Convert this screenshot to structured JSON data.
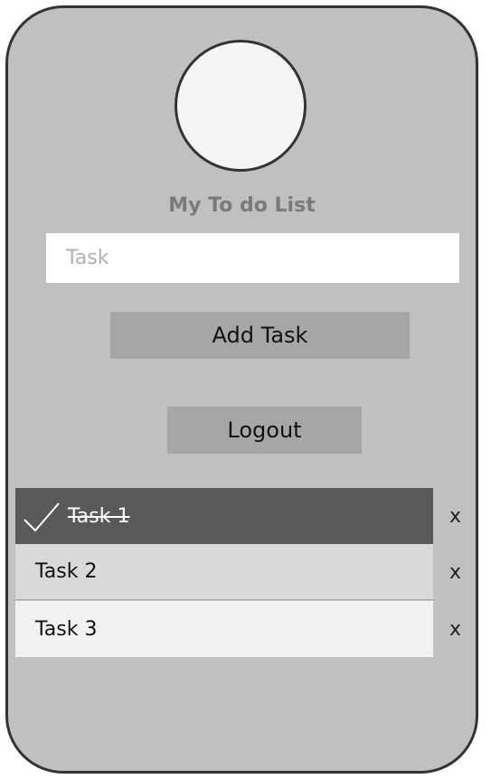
{
  "app": {
    "title": "My To do List"
  },
  "input": {
    "placeholder": "Task",
    "value": ""
  },
  "buttons": {
    "add_label": "Add Task",
    "logout_label": "Logout"
  },
  "tasks": [
    {
      "label": "Task 1",
      "completed": true,
      "delete_label": "x"
    },
    {
      "label": "Task 2",
      "completed": false,
      "delete_label": "x"
    },
    {
      "label": "Task 3",
      "completed": false,
      "delete_label": "x"
    }
  ],
  "colors": {
    "frame_background": "#c0c0c0",
    "frame_border": "#333333",
    "button_background": "#a6a6a6",
    "completed_row": "#595959",
    "row_2": "#d9d9d9",
    "row_3": "#f2f2f2",
    "title_text": "#7a7a7a"
  },
  "icons": {
    "avatar": "avatar-circle",
    "completed_mark": "check-icon"
  }
}
